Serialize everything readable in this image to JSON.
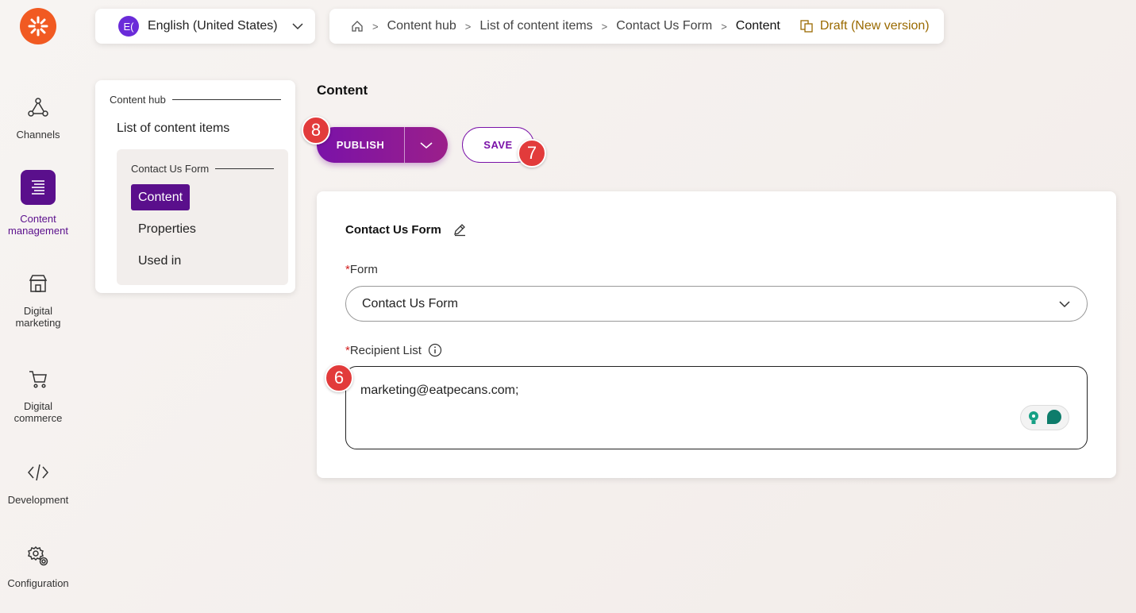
{
  "rail": {
    "items": [
      {
        "label": "Channels",
        "icon": "channels-icon"
      },
      {
        "label": "Content\nmanagement",
        "icon": "content-management-icon",
        "active": true
      },
      {
        "label": "Digital\nmarketing",
        "icon": "digital-marketing-icon"
      },
      {
        "label": "Digital\ncommerce",
        "icon": "cart-icon"
      },
      {
        "label": "Development",
        "icon": "code-icon"
      },
      {
        "label": "Configuration",
        "icon": "gear-icon"
      }
    ]
  },
  "language": {
    "badge": "E(",
    "label": "English (United States)"
  },
  "breadcrumb": {
    "items": [
      "Content hub",
      "List of content items",
      "Contact Us Form"
    ],
    "current": "Content",
    "status": "Draft (New version)"
  },
  "tree": {
    "section": "Content hub",
    "list_label": "List of content items",
    "item_title": "Contact Us Form",
    "subitems": [
      "Content",
      "Properties",
      "Used in"
    ]
  },
  "main": {
    "title": "Content",
    "publish_label": "PUBLISH",
    "save_label": "SAVE",
    "badges": {
      "publish": "8",
      "save": "7",
      "recipient": "6"
    }
  },
  "form": {
    "title": "Contact Us Form",
    "form_field": {
      "required": "*",
      "label": "Form",
      "value": "Contact Us Form"
    },
    "recipient_field": {
      "required": "*",
      "label": "Recipient List",
      "value": "marketing@eatpecans.com;"
    }
  },
  "colors": {
    "accent": "#5a0f8c",
    "brand": "#f15a22",
    "badge": "#e23b3b",
    "draft": "#9a6a00"
  }
}
